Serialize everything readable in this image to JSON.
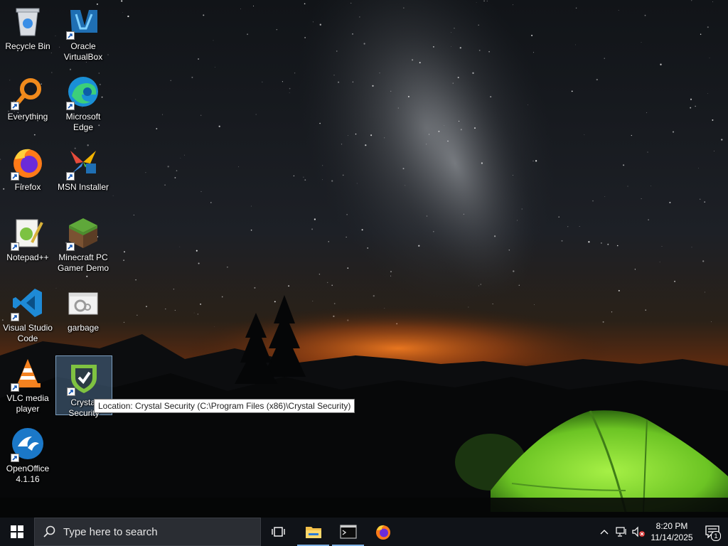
{
  "desktop": {
    "icons": [
      {
        "label": "Recycle Bin",
        "icon": "recycle-bin-icon"
      },
      {
        "label": "Oracle VirtualBox",
        "icon": "virtualbox-icon"
      },
      {
        "label": "Everything",
        "icon": "everything-search-icon"
      },
      {
        "label": "Microsoft Edge",
        "icon": "edge-icon"
      },
      {
        "label": "Firefox",
        "icon": "firefox-icon"
      },
      {
        "label": "MSN Installer",
        "icon": "msn-butterfly-icon"
      },
      {
        "label": "Notepad++",
        "icon": "notepadpp-icon"
      },
      {
        "label": "Minecraft PC Gamer Demo",
        "icon": "minecraft-grass-block-icon"
      },
      {
        "label": "Visual Studio Code",
        "icon": "vscode-icon"
      },
      {
        "label": "garbage",
        "icon": "settings-file-icon"
      },
      {
        "label": "VLC media player",
        "icon": "vlc-cone-icon"
      },
      {
        "label": "Crystal Security",
        "icon": "crystal-security-shield-icon"
      },
      {
        "label": "OpenOffice 4.1.16",
        "icon": "openoffice-icon"
      }
    ],
    "tooltip": "Location: Crystal Security (C:\\Program Files (x86)\\Crystal Security)"
  },
  "taskbar": {
    "search_placeholder": "Type here to search",
    "pinned": [
      {
        "name": "task-view",
        "icon": "task-view-icon"
      },
      {
        "name": "file-explorer",
        "icon": "folder-icon"
      },
      {
        "name": "command-prompt",
        "icon": "terminal-icon"
      },
      {
        "name": "firefox",
        "icon": "firefox-icon"
      }
    ],
    "clock": {
      "time": "8:20 PM",
      "date": "11/14/2025"
    },
    "notification_count": "1"
  },
  "colors": {
    "taskbar_bg": "#101318",
    "search_bg": "#2a2d33",
    "active_indicator": "#7fb2e5",
    "tent_green": "#8fe23a",
    "horizon_glow": "#e0651a"
  }
}
